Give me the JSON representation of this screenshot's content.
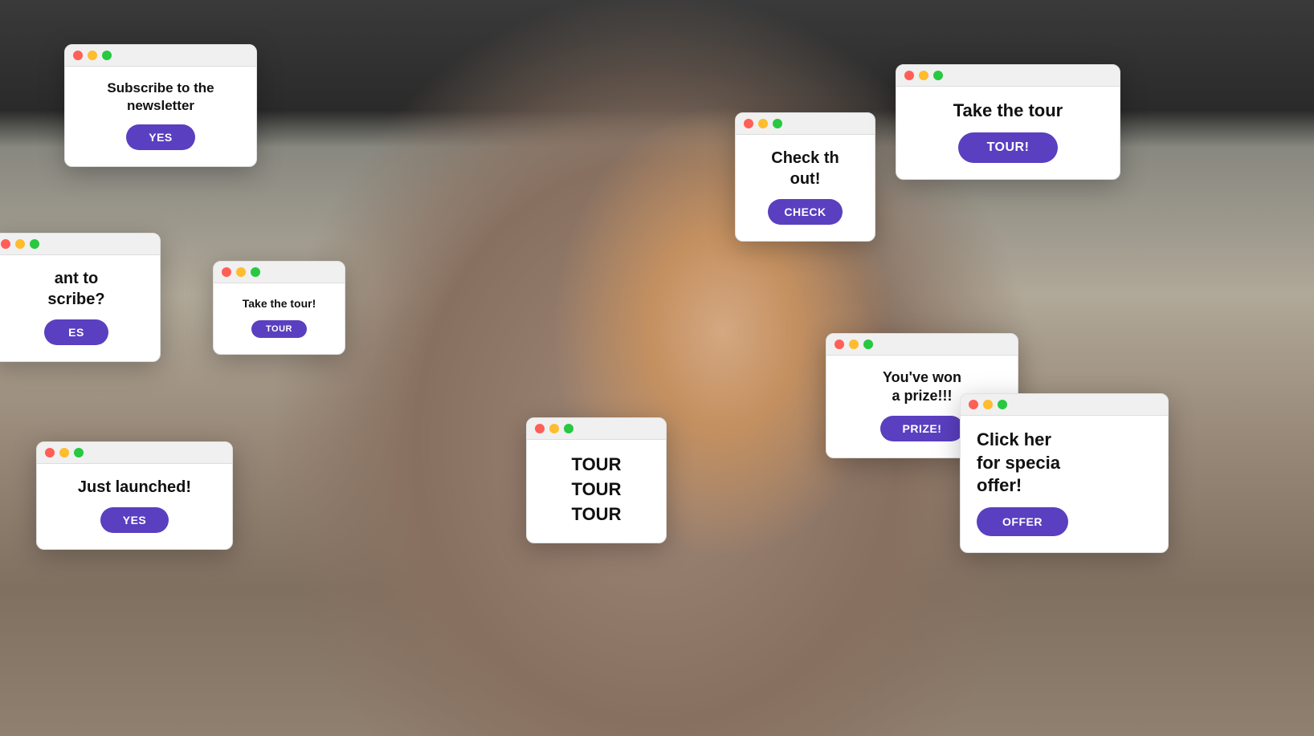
{
  "background": {
    "description": "Man at laptop looking shocked with popup windows overlaid"
  },
  "popups": {
    "subscribe_newsletter": {
      "title": "Subscribe to the newsletter",
      "button": "YES"
    },
    "want_subscribe": {
      "title": "ant to\nscribe?",
      "button": "ES"
    },
    "take_tour_small": {
      "title": "Take the\ntour!",
      "button": "TOUR"
    },
    "just_launched": {
      "title": "Just launched!",
      "button": "YES"
    },
    "check_this_out": {
      "title": "Check th\nout!",
      "button": "CHECK"
    },
    "take_tour_large": {
      "title": "Take the tour",
      "button": "TOUR!"
    },
    "tour_tour_tour": {
      "line1": "TOUR",
      "line2": "TOUR",
      "line3": "TOUR"
    },
    "won_prize": {
      "title": "You've won\na prize!!!",
      "button": "PRIZE!"
    },
    "click_here": {
      "title": "Click her\nfor specia\noffer!",
      "button": "OFFER"
    }
  },
  "dots": {
    "red": "#ff5f57",
    "yellow": "#febc2e",
    "green": "#28c840"
  }
}
